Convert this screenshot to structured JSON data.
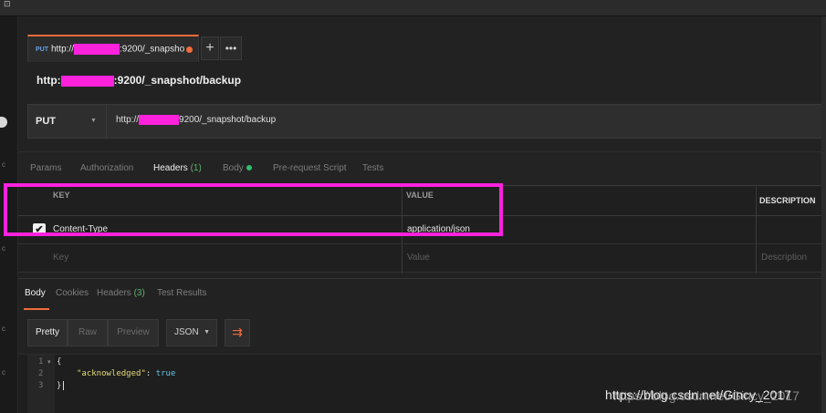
{
  "window": {
    "corner_glyph": "⊡"
  },
  "left_rail": {
    "marks": [
      "c",
      "c",
      "c",
      "c"
    ]
  },
  "tabs": {
    "active": {
      "method": "PUT",
      "name_prefix": "http://",
      "name_suffix": ":9200/_snapsho"
    },
    "add_label": "+",
    "more_label": "•••"
  },
  "request": {
    "title_prefix": "http:",
    "title_suffix": ":9200/_snapshot/backup",
    "method": "PUT",
    "url_prefix": "http://",
    "url_suffix": "9200/_snapshot/backup"
  },
  "request_tabs": {
    "params": "Params",
    "authorization": "Authorization",
    "headers": "Headers",
    "headers_count": "(1)",
    "body": "Body",
    "prerequest": "Pre-request Script",
    "tests": "Tests"
  },
  "headers_table": {
    "col_key": "KEY",
    "col_value": "VALUE",
    "col_description": "DESCRIPTION",
    "rows": [
      {
        "checked": "✔",
        "key": "Content-Type",
        "value": "application/json"
      }
    ],
    "placeholder": {
      "key": "Key",
      "value": "Value",
      "description": "Description"
    }
  },
  "response_tabs": {
    "body": "Body",
    "cookies": "Cookies",
    "headers": "Headers",
    "headers_count": "(3)",
    "test_results": "Test Results"
  },
  "response_toolbar": {
    "pretty": "Pretty",
    "raw": "Raw",
    "preview": "Preview",
    "format": "JSON",
    "wrap_icon": "⇉"
  },
  "response_body": {
    "lines": [
      "1",
      "2",
      "3"
    ],
    "open_brace": "{",
    "key": "\"acknowledged\"",
    "colon": ": ",
    "value": "true",
    "close_brace": "}"
  },
  "watermark": {
    "text": "https://blog.csdn.net/Gincy_2017",
    "ghost": "https://blog.csdn.net/Gincy_2017"
  },
  "colors": {
    "accent": "#f26b3a",
    "highlight": "#ff22dd",
    "status_green": "#2fbf71"
  }
}
